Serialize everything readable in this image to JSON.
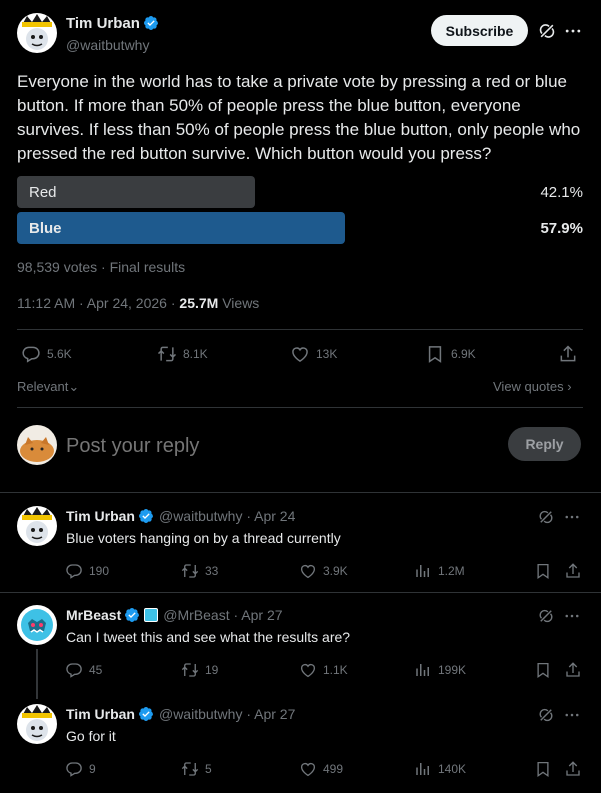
{
  "post": {
    "author_name": "Tim Urban",
    "handle": "@waitbutwhy",
    "subscribe_label": "Subscribe",
    "text": "Everyone in the world has to take a private vote by pressing a red or blue button. If more than 50% of people press the blue button, everyone survives. If less than 50% of people press the blue button, only people who pressed the red button survive. Which button would you press?",
    "poll": {
      "options": [
        {
          "label": "Red",
          "percent_text": "42.1%",
          "fraction": 0.421,
          "color": "#3a3d40",
          "winner": false
        },
        {
          "label": "Blue",
          "percent_text": "57.9%",
          "fraction": 0.579,
          "color": "#1e5a8e",
          "winner": true
        }
      ],
      "summary": "98,539 votes · Final results"
    },
    "time": "11:12 AM · Apr 24, 2026 · ",
    "views_count": "25.7M",
    "views_label": "Views",
    "stats": {
      "replies": "5.6K",
      "reposts": "8.1K",
      "likes": "13K",
      "bookmarks": "6.9K"
    }
  },
  "sort": {
    "label": "Relevant",
    "view_quotes": "View quotes"
  },
  "reply_box": {
    "placeholder": "Post your reply",
    "button": "Reply"
  },
  "replies": [
    {
      "name": "Tim Urban",
      "handle": "@waitbutwhy",
      "date": "Apr 24",
      "text": "Blue voters hanging on by a thread currently",
      "replies": "190",
      "reposts": "33",
      "likes": "3.9K",
      "views": "1.2M"
    },
    {
      "name": "MrBeast",
      "handle": "@MrBeast",
      "date": "Apr 27",
      "text": "Can I tweet this and see what the results are?",
      "replies": "45",
      "reposts": "19",
      "likes": "1.1K",
      "views": "199K"
    },
    {
      "name": "Tim Urban",
      "handle": "@waitbutwhy",
      "date": "Apr 27",
      "text": "Go for it",
      "replies": "9",
      "reposts": "5",
      "likes": "499",
      "views": "140K"
    }
  ],
  "colors": {
    "accent": "#1d9bf0",
    "background": "#000000",
    "border": "#2f3336",
    "muted": "#71767b"
  }
}
